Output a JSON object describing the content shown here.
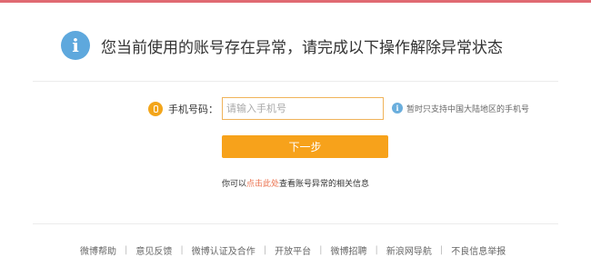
{
  "notice": {
    "icon": "info-icon",
    "text": "您当前使用的账号存在异常，请完成以下操作解除异常状态"
  },
  "phone": {
    "icon": "phone-icon",
    "label": "手机号码：",
    "placeholder": "请输入手机号",
    "tip_icon": "info-icon",
    "tip": "暂时只支持中国大陆地区的手机号"
  },
  "next_button": "下一步",
  "help": {
    "prefix": "你可以",
    "link": "点击此处",
    "suffix": "查看账号异常的相关信息"
  },
  "footer": {
    "separator": "|",
    "links": [
      "微博帮助",
      "意见反馈",
      "微博认证及合作",
      "开放平台",
      "微博招聘",
      "新浪网导航",
      "不良信息举报"
    ]
  },
  "colors": {
    "accent_orange": "#f7a21b",
    "info_blue": "#5ea8dd",
    "link_orange": "#eb7350",
    "top_border": "#e06a72"
  }
}
